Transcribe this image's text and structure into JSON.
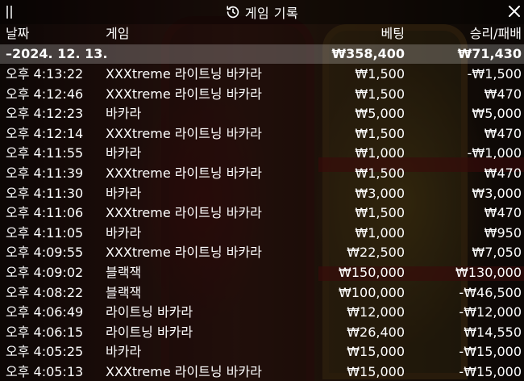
{
  "header": {
    "title": "게임 기록"
  },
  "columns": {
    "date": "날짜",
    "game": "게임",
    "bet": "베팅",
    "result": "승리/패배"
  },
  "date_group": {
    "date": "–2024. 12. 13.",
    "bet_total": "₩358,400",
    "result_total": "₩71,430"
  },
  "rows": [
    {
      "time": "오후 4:13:22",
      "game": "XXXtreme 라이트닝 바카라",
      "bet": "₩1,500",
      "result": "-₩1,500"
    },
    {
      "time": "오후 4:12:46",
      "game": "XXXtreme 라이트닝 바카라",
      "bet": "₩1,500",
      "result": "₩470"
    },
    {
      "time": "오후 4:12:23",
      "game": "바카라",
      "bet": "₩5,000",
      "result": "₩5,000"
    },
    {
      "time": "오후 4:12:14",
      "game": "XXXtreme 라이트닝 바카라",
      "bet": "₩1,500",
      "result": "₩470"
    },
    {
      "time": "오후 4:11:55",
      "game": "바카라",
      "bet": "₩1,000",
      "result": "-₩1,000"
    },
    {
      "time": "오후 4:11:39",
      "game": "XXXtreme 라이트닝 바카라",
      "bet": "₩1,500",
      "result": "₩470"
    },
    {
      "time": "오후 4:11:30",
      "game": "바카라",
      "bet": "₩3,000",
      "result": "₩3,000"
    },
    {
      "time": "오후 4:11:06",
      "game": "XXXtreme 라이트닝 바카라",
      "bet": "₩1,500",
      "result": "₩470"
    },
    {
      "time": "오후 4:11:05",
      "game": "바카라",
      "bet": "₩1,000",
      "result": "₩950"
    },
    {
      "time": "오후 4:09:55",
      "game": "XXXtreme 라이트닝 바카라",
      "bet": "₩22,500",
      "result": "₩7,050"
    },
    {
      "time": "오후 4:09:02",
      "game": "블랙잭",
      "bet": "₩150,000",
      "result": "₩130,000"
    },
    {
      "time": "오후 4:08:22",
      "game": "블랙잭",
      "bet": "₩100,000",
      "result": "-₩46,500"
    },
    {
      "time": "오후 4:06:49",
      "game": "라이트닝 바카라",
      "bet": "₩12,000",
      "result": "-₩12,000"
    },
    {
      "time": "오후 4:06:15",
      "game": "라이트닝 바카라",
      "bet": "₩26,400",
      "result": "₩14,550"
    },
    {
      "time": "오후 4:05:25",
      "game": "바카라",
      "bet": "₩15,000",
      "result": "-₩15,000"
    },
    {
      "time": "오후 4:05:13",
      "game": "XXXtreme 라이트닝 바카라",
      "bet": "₩15,000",
      "result": "-₩15,000"
    }
  ],
  "icons": {
    "drag": "drag-handle-icon",
    "history": "history-icon",
    "close": "close-icon"
  }
}
